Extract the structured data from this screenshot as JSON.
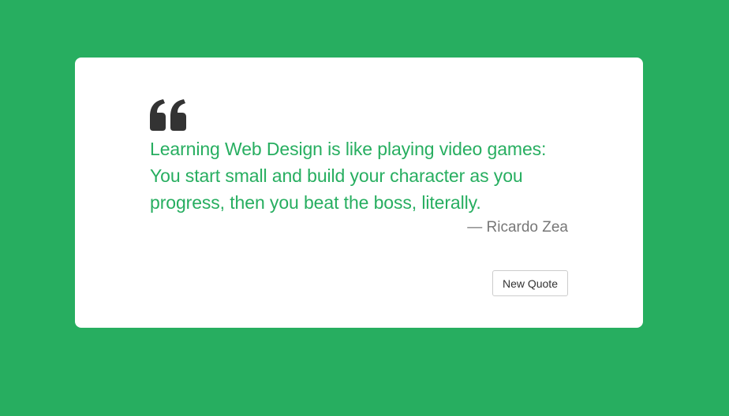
{
  "colors": {
    "background": "#27ae60",
    "card": "#ffffff",
    "quote_text": "#27ae60",
    "author_text": "#777777",
    "icon": "#333333"
  },
  "quote": {
    "icon": "quote-left-icon",
    "text": "Learning Web Design is like playing video games: You start small and build your character as you progress, then you beat the boss, literally.",
    "author": "— Ricardo Zea"
  },
  "actions": {
    "new_quote_label": "New Quote"
  }
}
